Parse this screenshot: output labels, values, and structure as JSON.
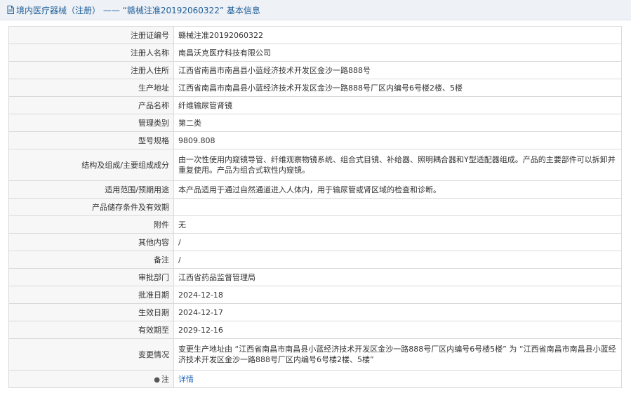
{
  "header": {
    "title": "境内医疗器械（注册） —— “赣械注准20192060322” 基本信息"
  },
  "rows": [
    {
      "label": "注册证编号",
      "value": "赣械注准20192060322"
    },
    {
      "label": "注册人名称",
      "value": "南昌沃克医疗科技有限公司"
    },
    {
      "label": "注册人住所",
      "value": "江西省南昌市南昌县小蓝经济技术开发区金沙一路888号"
    },
    {
      "label": "生产地址",
      "value": "江西省南昌市南昌县小蓝经济技术开发区金沙一路888号厂区内编号6号楼2楼、5楼"
    },
    {
      "label": "产品名称",
      "value": "纤维输尿管肾镜"
    },
    {
      "label": "管理类别",
      "value": "第二类"
    },
    {
      "label": "型号规格",
      "value": "9809.808"
    },
    {
      "label": "结构及组成/主要组成成分",
      "value": "由一次性使用内窥镜导管、纤维观察物镜系统、组合式目镜、补给器、照明耦合器和Y型适配器组成。产品的主要部件可以拆卸并重复使用。产品为组合式软性内窥镜。"
    },
    {
      "label": "适用范围/预期用途",
      "value": "本产品适用于通过自然通道进入人体内，用于输尿管或肾区域的检查和诊断。"
    },
    {
      "label": "产品储存条件及有效期",
      "value": ""
    },
    {
      "label": "附件",
      "value": "无"
    },
    {
      "label": "其他内容",
      "value": "/"
    },
    {
      "label": "备注",
      "value": "/"
    },
    {
      "label": "审批部门",
      "value": "江西省药品监督管理局"
    },
    {
      "label": "批准日期",
      "value": "2024-12-18"
    },
    {
      "label": "生效日期",
      "value": "2024-12-17"
    },
    {
      "label": "有效期至",
      "value": "2029-12-16"
    },
    {
      "label": "变更情况",
      "value": "变更生产地址由 “江西省南昌市南昌县小蓝经济技术开发区金沙一路888号厂区内编号6号楼5楼” 为 “江西省南昌市南昌县小蓝经济技术开发区金沙一路888号厂区内编号6号楼2楼、5楼”"
    }
  ],
  "note": {
    "icon": "note-icon",
    "label": "注",
    "link_text": "详情"
  }
}
